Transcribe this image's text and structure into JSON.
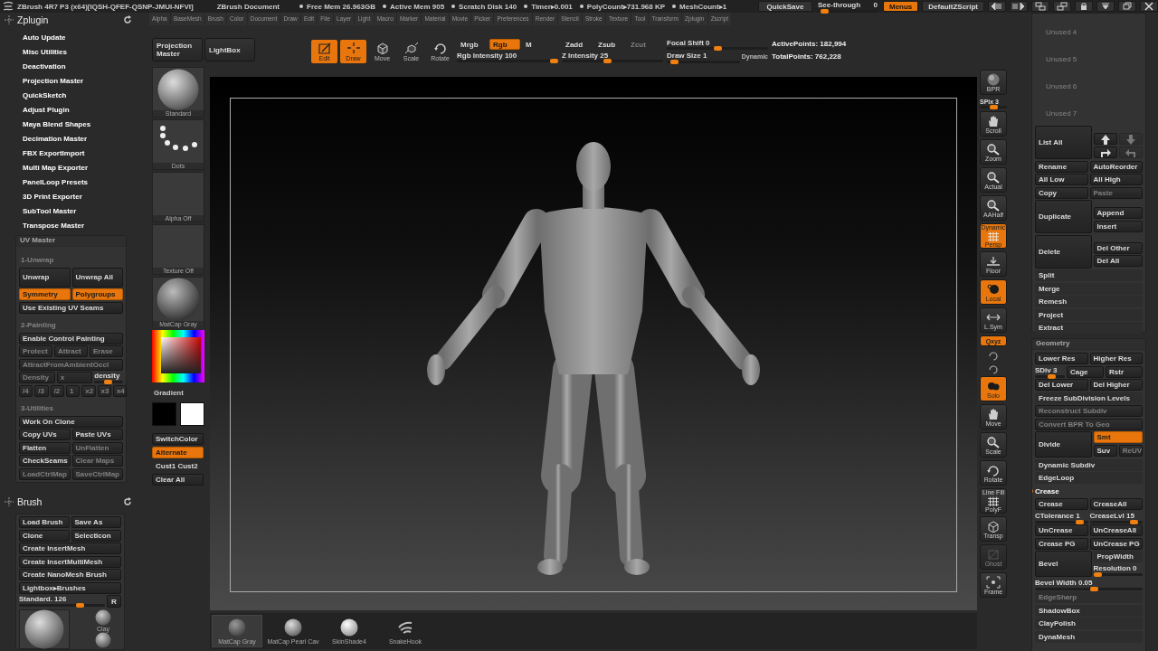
{
  "title_bar": {
    "app": "ZBrush 4R7 P3 (x64)[IQSH-QFEF-QSNP-JMUI-NFVI]",
    "document": "ZBrush Document",
    "stats": [
      "Free Mem 26.963GB",
      "Active Mem 905",
      "Scratch Disk 140",
      "Timer▸0.001",
      "PolyCount▸731.968 KP",
      "MeshCount▸1"
    ],
    "quicksave": "QuickSave",
    "see_through": {
      "label": "See-through",
      "reading": "0",
      "level": 0.05
    },
    "menus": {
      "label": "Menus",
      "selected": true
    },
    "script": "DefaultZScript"
  },
  "menu_bar": [
    "Alpha",
    "BaseMesh",
    "Brush",
    "Color",
    "Document",
    "Draw",
    "Edit",
    "File",
    "Layer",
    "Light",
    "Macro",
    "Marker",
    "Material",
    "Movie",
    "Picker",
    "Preferences",
    "Render",
    "Stencil",
    "Stroke",
    "Texture",
    "Tool",
    "Transform",
    "Zplugin",
    "Zscript"
  ],
  "zplugin": {
    "title": "Zplugin",
    "items": [
      "Auto Update",
      "Misc Utilities",
      "Deactivation",
      "Projection Master",
      "QuickSketch",
      "Adjust Plugin",
      "Maya Blend Shapes",
      "Decimation Master",
      "FBX ExportImport",
      "Multi Map Exporter",
      "PanelLoop Presets",
      "3D Print Exporter",
      "SubTool Master",
      "Transpose Master"
    ],
    "uv_master": {
      "title": "UV Master",
      "rows": [
        [
          {
            "kind": "heading",
            "label": "1-Unwrap"
          }
        ],
        [
          {
            "kind": "big-button",
            "label": "Unwrap",
            "on": false,
            "disabled": false
          },
          {
            "kind": "big-button",
            "label": "Unwrap All",
            "on": false,
            "disabled": false
          }
        ],
        [
          {
            "kind": "button",
            "label": "Symmetry",
            "on": true,
            "disabled": false
          },
          {
            "kind": "button",
            "label": "Polygroups",
            "on": true,
            "disabled": false
          }
        ],
        [
          {
            "kind": "button",
            "label": "Use Existing UV Seams",
            "on": false,
            "disabled": false
          }
        ],
        [
          {
            "kind": "heading",
            "label": "2-Painting"
          }
        ],
        [
          {
            "kind": "button",
            "label": "Enable Control Painting",
            "on": false,
            "disabled": false
          }
        ],
        [
          {
            "kind": "button",
            "label": "Protect",
            "on": false,
            "disabled": true
          },
          {
            "kind": "button",
            "label": "Attract",
            "on": false,
            "disabled": true
          },
          {
            "kind": "button",
            "label": "Erase",
            "on": false,
            "disabled": true
          }
        ],
        [
          {
            "kind": "button",
            "label": "AttractFromAmbientOccl",
            "on": false,
            "disabled": true
          }
        ],
        [
          {
            "kind": "button",
            "label": "Density",
            "on": false,
            "disabled": true
          },
          {
            "kind": "button",
            "label": "x",
            "on": false,
            "disabled": true
          },
          {
            "kind": "slider",
            "label": "density",
            "level": 0.45
          }
        ],
        [
          {
            "kind": "steps",
            "items": [
              {
                "label": "/4",
                "on": false,
                "disabled": true
              },
              {
                "label": "/3",
                "on": false,
                "disabled": true
              },
              {
                "label": "/2",
                "on": false,
                "disabled": true
              },
              {
                "label": "1",
                "on": false,
                "disabled": true
              },
              {
                "label": "x2",
                "on": false,
                "disabled": true
              },
              {
                "label": "x3",
                "on": false,
                "disabled": true
              },
              {
                "label": "x4",
                "on": false,
                "disabled": true
              }
            ]
          }
        ],
        [
          {
            "kind": "heading",
            "label": "3-Utilities"
          }
        ],
        [
          {
            "kind": "button",
            "label": "Work On Clone",
            "on": false,
            "disabled": false
          }
        ],
        [
          {
            "kind": "button",
            "label": "Copy UVs",
            "on": false,
            "disabled": false
          },
          {
            "kind": "button",
            "label": "Paste UVs",
            "on": false,
            "disabled": false
          }
        ],
        [
          {
            "kind": "button",
            "label": "Flatten",
            "on": false,
            "disabled": false
          },
          {
            "kind": "button",
            "label": "UnFlatten",
            "on": false,
            "disabled": true
          }
        ],
        [
          {
            "kind": "button",
            "label": "CheckSeams",
            "on": false,
            "disabled": false
          },
          {
            "kind": "button",
            "label": "Clear Maps",
            "on": false,
            "disabled": true
          }
        ],
        [
          {
            "kind": "button",
            "label": "LoadCtrlMap",
            "on": false,
            "disabled": true
          },
          {
            "kind": "button",
            "label": "SaveCtrlMap",
            "on": false,
            "disabled": true
          }
        ]
      ]
    }
  },
  "brush_panel": {
    "title": "Brush",
    "rows": [
      [
        {
          "kind": "button",
          "label": "Load Brush",
          "on": false,
          "disabled": false
        },
        {
          "kind": "button",
          "label": "Save As",
          "on": false,
          "disabled": false
        }
      ],
      [
        {
          "kind": "button",
          "label": "Clone",
          "on": false,
          "disabled": false
        },
        {
          "kind": "button",
          "label": "SelectIcon",
          "on": false,
          "disabled": false
        }
      ],
      [
        {
          "kind": "button",
          "label": "Create InsertMesh",
          "on": false,
          "disabled": false
        }
      ],
      [
        {
          "kind": "button",
          "label": "Create InsertMultiMesh",
          "on": false,
          "disabled": false
        }
      ],
      [
        {
          "kind": "button",
          "label": "Create NanoMesh Brush",
          "on": false,
          "disabled": false
        }
      ],
      [
        {
          "kind": "button",
          "label": "Lightbox▸Brushes",
          "on": false,
          "disabled": false
        }
      ],
      [
        {
          "kind": "slider",
          "label": "Standard. 126",
          "level": 0.73
        },
        {
          "kind": "small-button",
          "label": "R",
          "on": false,
          "disabled": false
        }
      ]
    ],
    "thumbs": [
      {
        "kind": "big"
      },
      {
        "kind": "small",
        "label": "Clay"
      },
      {
        "kind": "small"
      }
    ]
  },
  "toolbar": {
    "left_buttons": [
      "Projection Master",
      "LightBox"
    ],
    "modes": [
      {
        "kind": "edit",
        "label": "Edit",
        "on": true
      },
      {
        "kind": "draw",
        "label": "Draw",
        "on": true
      },
      {
        "kind": "move",
        "label": "Move",
        "on": false
      },
      {
        "kind": "scale",
        "label": "Scale",
        "on": false
      },
      {
        "kind": "rotate",
        "label": "Rotate",
        "on": false
      }
    ],
    "rgb": [
      {
        "label": "Mrgb",
        "on": false,
        "disabled": false
      },
      {
        "label": "Rgb",
        "on": true,
        "disabled": false
      },
      {
        "label": "M",
        "on": false,
        "disabled": false
      }
    ],
    "z": [
      {
        "label": "Zadd",
        "on": false,
        "disabled": false
      },
      {
        "label": "Zsub",
        "on": false,
        "disabled": false
      },
      {
        "label": "Zcut",
        "on": false,
        "disabled": true
      }
    ],
    "sliders": [
      {
        "label": "Rgb Intensity 100",
        "level": 1
      },
      {
        "label": "Z Intensity 25",
        "level": 0.45
      },
      {
        "label": "Focal Shift 0",
        "level": 0.5
      },
      {
        "label": "Draw Size 1",
        "level": 0.05
      }
    ],
    "dynamic": "Dynamic",
    "points": [
      "ActivePoints: 182,994",
      "TotalPoints: 762,228"
    ]
  },
  "tool_column": {
    "thumbs": [
      {
        "kind": "brush",
        "label": "Standard"
      },
      {
        "kind": "dots",
        "label": "Dots"
      },
      {
        "kind": "empty",
        "label": "Alpha Off"
      },
      {
        "kind": "empty",
        "label": "Texture Off"
      },
      {
        "kind": "matcap",
        "label": "MatCap Gray"
      }
    ],
    "color_label": "Gradient",
    "swatches": [
      {
        "color": "#000000"
      },
      {
        "color": "#ffffff"
      }
    ],
    "buttons": [
      {
        "kind": "button",
        "label": "SwitchColor",
        "on": false
      },
      {
        "kind": "button",
        "label": "Alternate",
        "on": true
      },
      {
        "kind": "text",
        "label": "Cust1 Cust2",
        "on": false
      },
      {
        "kind": "button",
        "label": "Clear All",
        "on": false
      }
    ]
  },
  "right_tools": [
    {
      "kind": "sphere",
      "label": "BPR",
      "on": false,
      "disabled": false
    },
    {
      "kind": "slider",
      "label": "SPix 3",
      "level": 0.5
    },
    {
      "kind": "hand",
      "label": "Scroll",
      "on": false,
      "disabled": false
    },
    {
      "kind": "magnifier",
      "label": "Zoom",
      "on": false,
      "disabled": false
    },
    {
      "kind": "magnifier",
      "label": "Actual",
      "on": false,
      "disabled": false
    },
    {
      "kind": "magnifier",
      "label": "AAHalf",
      "on": false,
      "disabled": false
    },
    {
      "kind": "grid",
      "label": "Persp",
      "caption": "Dynamic",
      "on": true,
      "disabled": false
    },
    {
      "kind": "floor",
      "label": "Floor",
      "on": false,
      "disabled": false
    },
    {
      "kind": "local",
      "label": "Local",
      "on": true,
      "disabled": false
    },
    {
      "kind": "axes",
      "label": "L.Sym",
      "on": false,
      "disabled": false
    },
    {
      "kind": "pill",
      "label": "Qxyz",
      "on": true,
      "disabled": false
    },
    {
      "kind": "mini",
      "on": false,
      "disabled": false
    },
    {
      "kind": "mini",
      "on": false,
      "disabled": false
    },
    {
      "kind": "solo",
      "label": "Solo",
      "on": true,
      "disabled": false
    },
    {
      "kind": "hand",
      "label": "Move",
      "on": false,
      "disabled": false
    },
    {
      "kind": "magnifier",
      "label": "Scale",
      "on": false,
      "disabled": false
    },
    {
      "kind": "rotate",
      "label": "Rotate",
      "on": false,
      "disabled": false
    },
    {
      "kind": "grid",
      "label": "PolyF",
      "caption": "Line Fill",
      "on": false,
      "disabled": false
    },
    {
      "kind": "transp",
      "label": "Transp",
      "on": false,
      "disabled": false
    },
    {
      "kind": "ghost",
      "label": "Ghost",
      "on": false,
      "disabled": true
    },
    {
      "kind": "frame",
      "label": "Frame",
      "on": false,
      "disabled": false
    }
  ],
  "shelf": [
    {
      "kind": "matcap",
      "label": "MatCap Gray",
      "selected": true
    },
    {
      "kind": "pearl",
      "label": "MatCap Pearl Cav",
      "selected": false
    },
    {
      "kind": "skin",
      "label": "SkinShade4",
      "selected": false
    },
    {
      "kind": "brush",
      "label": "SnakeHook",
      "selected": false
    }
  ],
  "subtool": {
    "unused": [
      "Unused 4",
      "Unused 5",
      "Unused 6",
      "Unused 7"
    ],
    "rows": [
      [
        {
          "kind": "big-button",
          "label": "List All",
          "on": false,
          "disabled": false
        },
        {
          "kind": "stack",
          "rows": [
            [
              {
                "kind": "arrow-up",
                "disabled": false
              },
              {
                "kind": "arrow-down",
                "disabled": true
              }
            ],
            [
              {
                "kind": "turn-right",
                "disabled": false
              },
              {
                "kind": "turn-left",
                "disabled": true
              }
            ]
          ]
        }
      ],
      [
        {
          "kind": "button",
          "label": "Rename",
          "on": false,
          "disabled": false
        },
        {
          "kind": "button",
          "label": "AutoReorder",
          "on": false,
          "disabled": false
        }
      ],
      [
        {
          "kind": "button",
          "label": "All Low",
          "on": false,
          "disabled": false
        },
        {
          "kind": "button",
          "label": "All High",
          "on": false,
          "disabled": false
        }
      ],
      [
        {
          "kind": "button",
          "label": "Copy",
          "on": false,
          "disabled": false
        },
        {
          "kind": "button",
          "label": "Paste",
          "on": false,
          "disabled": true
        }
      ],
      [
        {
          "kind": "big-button",
          "label": "Duplicate",
          "on": false,
          "disabled": false
        },
        {
          "kind": "stack",
          "rows": [
            [
              {
                "kind": "button",
                "label": "Append",
                "on": false,
                "disabled": false
              }
            ],
            [
              {
                "kind": "button",
                "label": "Insert",
                "on": false,
                "disabled": false
              }
            ]
          ]
        }
      ],
      [
        {
          "kind": "big-button",
          "label": "Delete",
          "on": false,
          "disabled": false
        },
        {
          "kind": "stack",
          "rows": [
            [
              {
                "kind": "button",
                "label": "Del Other",
                "on": false,
                "disabled": false
              }
            ],
            [
              {
                "kind": "button",
                "label": "Del All",
                "on": false,
                "disabled": false
              }
            ]
          ]
        }
      ],
      [
        {
          "kind": "flat",
          "label": "Split",
          "on": false,
          "disabled": false
        }
      ],
      [
        {
          "kind": "flat",
          "label": "Merge",
          "on": false,
          "disabled": false
        }
      ],
      [
        {
          "kind": "flat",
          "label": "Remesh",
          "on": false,
          "disabled": false
        }
      ],
      [
        {
          "kind": "flat",
          "label": "Project",
          "on": false,
          "disabled": false
        }
      ],
      [
        {
          "kind": "flat",
          "label": "Extract",
          "on": false,
          "disabled": false
        }
      ]
    ]
  },
  "geometry": {
    "title": "Geometry",
    "rows": [
      [
        {
          "kind": "button",
          "label": "Lower Res",
          "on": false,
          "disabled": false
        },
        {
          "kind": "button",
          "label": "Higher Res",
          "on": false,
          "disabled": false
        }
      ],
      [
        {
          "kind": "slider",
          "label": "SDiv 3",
          "level": 0.6
        },
        {
          "kind": "button",
          "label": "Cage",
          "on": false,
          "disabled": false
        },
        {
          "kind": "button",
          "label": "Rstr",
          "on": false,
          "disabled": false
        }
      ],
      [
        {
          "kind": "button",
          "label": "Del Lower",
          "on": false,
          "disabled": false
        },
        {
          "kind": "button",
          "label": "Del Higher",
          "on": false,
          "disabled": false
        }
      ],
      [
        {
          "kind": "flat",
          "label": "Freeze SubDivision Levels",
          "on": false,
          "disabled": false
        }
      ],
      [
        {
          "kind": "button",
          "label": "Reconstruct Subdiv",
          "on": false,
          "disabled": true
        }
      ],
      [
        {
          "kind": "button",
          "label": "Convert BPR To Geo",
          "on": false,
          "disabled": true
        }
      ],
      [
        {
          "kind": "big-button",
          "label": "Divide",
          "on": false,
          "disabled": false
        },
        {
          "kind": "stack",
          "rows": [
            [
              {
                "kind": "button",
                "label": "Smt",
                "on": true,
                "disabled": false
              }
            ],
            [
              {
                "kind": "button",
                "label": "Suv",
                "on": false,
                "disabled": false
              },
              {
                "kind": "button",
                "label": "ReUV",
                "on": false,
                "disabled": true
              }
            ]
          ]
        }
      ],
      [
        {
          "kind": "flat",
          "label": "Dynamic Subdiv",
          "on": false,
          "disabled": false
        }
      ],
      [
        {
          "kind": "flat",
          "label": "EdgeLoop",
          "on": false,
          "disabled": false
        }
      ],
      [
        {
          "kind": "marked",
          "label": "Crease"
        }
      ],
      [
        {
          "kind": "button",
          "label": "Crease",
          "on": false,
          "disabled": false
        },
        {
          "kind": "button",
          "label": "CreaseAll",
          "on": false,
          "disabled": false
        }
      ],
      [
        {
          "kind": "slider",
          "label": "CTolerance 1",
          "level": 0.9
        },
        {
          "kind": "slider",
          "label": "CreaseLvl 15",
          "level": 0.9
        }
      ],
      [
        {
          "kind": "button",
          "label": "UnCrease",
          "on": false,
          "disabled": false
        },
        {
          "kind": "button",
          "label": "UnCreaseAll",
          "on": false,
          "disabled": false
        }
      ],
      [
        {
          "kind": "button",
          "label": "Crease PG",
          "on": false,
          "disabled": false
        },
        {
          "kind": "button",
          "label": "UnCrease PG",
          "on": false,
          "disabled": false
        }
      ],
      [
        {
          "kind": "big-button",
          "label": "Bevel",
          "on": false,
          "disabled": false
        },
        {
          "kind": "stack",
          "rows": [
            [
              {
                "kind": "flat",
                "label": "PropWidth",
                "on": false,
                "disabled": false
              }
            ],
            [
              {
                "kind": "slider",
                "label": "Resolution 0",
                "level": 0
              }
            ]
          ]
        }
      ],
      [
        {
          "kind": "slider",
          "label": "Bevel Width 0.05",
          "level": 0.55
        }
      ],
      [
        {
          "kind": "flat",
          "label": "EdgeSharp",
          "on": false,
          "disabled": true
        }
      ],
      [
        {
          "kind": "flat",
          "label": "ShadowBox",
          "on": false,
          "disabled": false
        }
      ],
      [
        {
          "kind": "flat",
          "label": "ClayPolish",
          "on": false,
          "disabled": false
        }
      ],
      [
        {
          "kind": "flat",
          "label": "DynaMesh",
          "on": false,
          "disabled": false
        }
      ]
    ]
  }
}
